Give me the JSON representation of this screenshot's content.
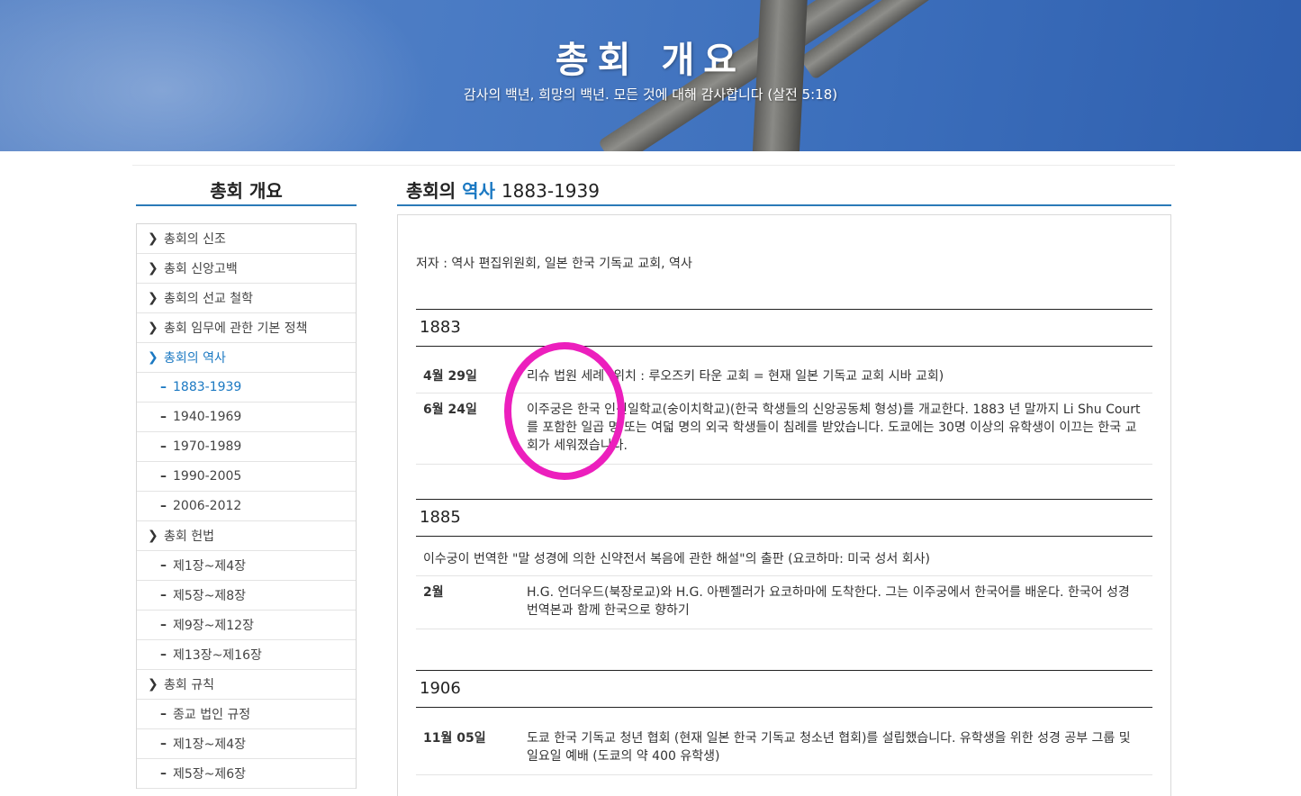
{
  "hero": {
    "title": "총회 개요",
    "subtitle": "감사의 백년, 희망의 백년. 모든 것에 대해 감사합니다 (살전 5:18)"
  },
  "sidebar": {
    "title": "총회 개요",
    "items": [
      {
        "label": "총회의 신조",
        "level": 1,
        "active": false
      },
      {
        "label": "총회 신앙고백",
        "level": 1,
        "active": false
      },
      {
        "label": "총회의 선교 철학",
        "level": 1,
        "active": false
      },
      {
        "label": "총회 임무에 관한 기본 정책",
        "level": 1,
        "active": false
      },
      {
        "label": "총회의 역사",
        "level": 1,
        "active": true
      },
      {
        "label": "1883-1939",
        "level": 2,
        "active": true
      },
      {
        "label": "1940-1969",
        "level": 2,
        "active": false
      },
      {
        "label": "1970-1989",
        "level": 2,
        "active": false
      },
      {
        "label": "1990-2005",
        "level": 2,
        "active": false
      },
      {
        "label": "2006-2012",
        "level": 2,
        "active": false
      },
      {
        "label": "총회 헌법",
        "level": 1,
        "active": false
      },
      {
        "label": "제1장~제4장",
        "level": 2,
        "active": false
      },
      {
        "label": "제5장~제8장",
        "level": 2,
        "active": false
      },
      {
        "label": "제9장~제12장",
        "level": 2,
        "active": false
      },
      {
        "label": "제13장~제16장",
        "level": 2,
        "active": false
      },
      {
        "label": "총회 규칙",
        "level": 1,
        "active": false
      },
      {
        "label": "종교 법인 규정",
        "level": 2,
        "active": false
      },
      {
        "label": "제1장~제4장",
        "level": 2,
        "active": false
      },
      {
        "label": "제5장~제6장",
        "level": 2,
        "active": false
      }
    ]
  },
  "main": {
    "title_prefix": "총회의",
    "title_highlight": "역사",
    "title_years": "1883-1939",
    "author": "저자 : 역사 편집위원회, 일본 한국 기독교 교회, 역사",
    "years": [
      {
        "year": "1883",
        "rows": [
          {
            "date": "4월 29일",
            "text": "리슈 법원 세례 (위치 : 루오즈키 타운 교회 = 현재 일본 기독교 교회 시바 교회)"
          },
          {
            "date": "6월 24일",
            "text": "이주궁은 한국 인신일학교(숭이치학교)(한국 학생들의 신앙공동체 형성)를 개교한다. 1883 년 말까지 Li Shu Court를 포함한 일곱 명 또는 여덟 명의 외국 학생들이 침례를 받았습니다. 도쿄에는 30명 이상의 유학생이 이끄는 한국 교회가 세워졌습니다."
          }
        ]
      },
      {
        "year": "1885",
        "intro": "이수궁이 번역한 \"말 성경에 의한 신약전서 복음에 관한 해설\"의 출판 (요코하마: 미국 성서 회사)",
        "rows": [
          {
            "date": "2월",
            "text": "H.G. 언더우드(북장로교)와 H.G. 아펜젤러가 요코하마에 도착한다. 그는 이주궁에서 한국어를 배운다. 한국어 성경 번역본과 함께 한국으로 향하기"
          }
        ]
      },
      {
        "year": "1906",
        "rows": [
          {
            "date": "11월 05일",
            "text": "도쿄 한국 기독교 청년 협회 (현재 일본 한국 기독교 청소년 협회)를 설립했습니다. 유학생을 위한 성경 공부 그룹 및 일요일 예배 (도쿄의 약 400 유학생)"
          }
        ]
      }
    ]
  },
  "colors": {
    "accent": "#1a78c2",
    "annotation_circle": "#ec1fbd"
  }
}
